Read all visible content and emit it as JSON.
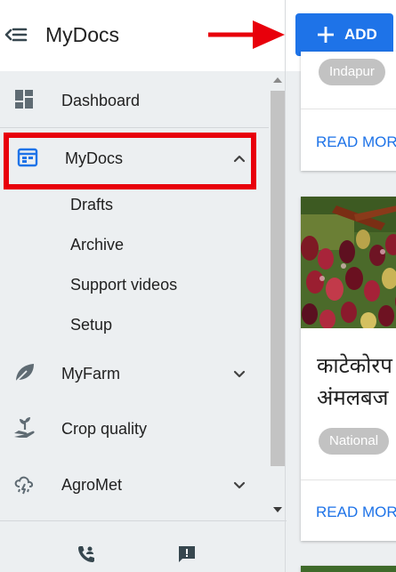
{
  "app": {
    "title": "MyDocs"
  },
  "sidebar": {
    "items": [
      {
        "label": "Dashboard",
        "icon": "dashboard-icon"
      },
      {
        "label": "MyDocs",
        "icon": "mydocs-icon",
        "expanded": true,
        "children": [
          "Drafts",
          "Archive",
          "Support videos",
          "Setup"
        ]
      },
      {
        "label": "MyFarm",
        "icon": "leaf-icon",
        "expandable": true
      },
      {
        "label": "Crop quality",
        "icon": "crop-quality-icon"
      },
      {
        "label": "AgroMet",
        "icon": "cloud-icon",
        "expandable": true
      }
    ],
    "bottom_icons": [
      "contact-phone-icon",
      "feedback-icon"
    ]
  },
  "toolbar": {
    "add_label": "ADD"
  },
  "cards": [
    {
      "chip": "Indapur",
      "action": "READ MORE"
    },
    {
      "title": "काटेकोरप\nअंमलबज",
      "chip": "National",
      "action": "READ MORE"
    }
  ],
  "colors": {
    "accent": "#1e73e8",
    "annotation": "#e8000b",
    "chip": "#c2c2c2"
  }
}
